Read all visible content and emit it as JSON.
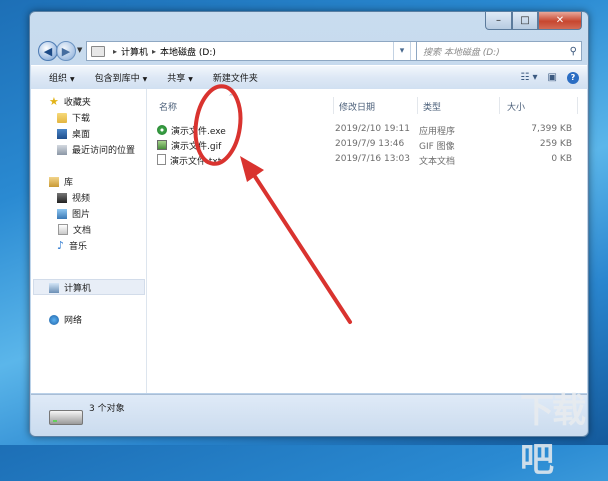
{
  "window": {
    "caption": {
      "min": "–",
      "max": "□",
      "close": "✕"
    }
  },
  "navigation": {
    "back": "◀",
    "forward": "▶",
    "breadcrumb": [
      "计算机",
      "本地磁盘 (D:)"
    ],
    "search_placeholder": "搜索 本地磁盘 (D:)"
  },
  "toolbar": {
    "items": [
      "组织",
      "包含到库中",
      "共享",
      "新建文件夹"
    ]
  },
  "nav_pane": {
    "favorites": {
      "label": "收藏夹",
      "items": [
        "下载",
        "桌面",
        "最近访问的位置"
      ]
    },
    "libraries": {
      "label": "库",
      "items": [
        "视频",
        "图片",
        "文档",
        "音乐"
      ]
    },
    "computer": "计算机",
    "network": "网络"
  },
  "file_list": {
    "columns": [
      "名称",
      "修改日期",
      "类型",
      "大小"
    ],
    "rows": [
      {
        "name": "演示文件.exe",
        "date": "2019/2/10 19:11",
        "type": "应用程序",
        "size": "7,399 KB",
        "icon": "exe-icon"
      },
      {
        "name": "演示文件.gif",
        "date": "2019/7/9 13:46",
        "type": "GIF 图像",
        "size": "259 KB",
        "icon": "image-icon"
      },
      {
        "name": "演示文件.txt",
        "date": "2019/7/16 13:03",
        "type": "文本文档",
        "size": "0 KB",
        "icon": "text-file-icon"
      }
    ]
  },
  "status_bar": {
    "item_count": "3 个对象"
  },
  "annotation": {
    "color": "#d9332f"
  },
  "watermark": {
    "text": "下载吧"
  }
}
